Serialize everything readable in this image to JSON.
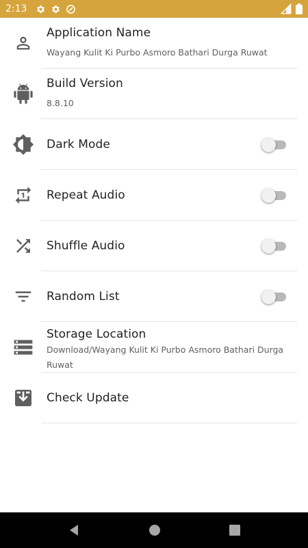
{
  "status_bar": {
    "time": "2:13",
    "icons_left": [
      "gear-icon",
      "gear-icon",
      "do-not-disturb-icon"
    ],
    "icons_right": [
      "cell-signal-icon",
      "battery-icon"
    ],
    "background": "#d6a43c"
  },
  "settings": [
    {
      "id": "app-name",
      "icon": "person-icon",
      "title": "Application Name",
      "subtitle": "Wayang Kulit Ki Purbo Asmoro Bathari Durga Ruwat"
    },
    {
      "id": "build-version",
      "icon": "android-icon",
      "title": "Build Version",
      "subtitle": "8.8.10"
    },
    {
      "id": "dark-mode",
      "icon": "brightness-icon",
      "title": "Dark Mode",
      "toggle": false
    },
    {
      "id": "repeat-audio",
      "icon": "repeat-one-icon",
      "title": "Repeat Audio",
      "toggle": false
    },
    {
      "id": "shuffle-audio",
      "icon": "shuffle-icon",
      "title": "Shuffle Audio",
      "toggle": false
    },
    {
      "id": "random-list",
      "icon": "filter-list-icon",
      "title": "Random List",
      "toggle": false
    },
    {
      "id": "storage-location",
      "icon": "storage-icon",
      "title": "Storage Location",
      "subtitle": "Download/Wayang Kulit Ki Purbo Asmoro Bathari Durga Ruwat"
    },
    {
      "id": "check-update",
      "icon": "download-box-icon",
      "title": "Check Update"
    }
  ],
  "nav_bar": {
    "buttons": [
      "back-icon",
      "home-icon",
      "recents-icon"
    ]
  }
}
